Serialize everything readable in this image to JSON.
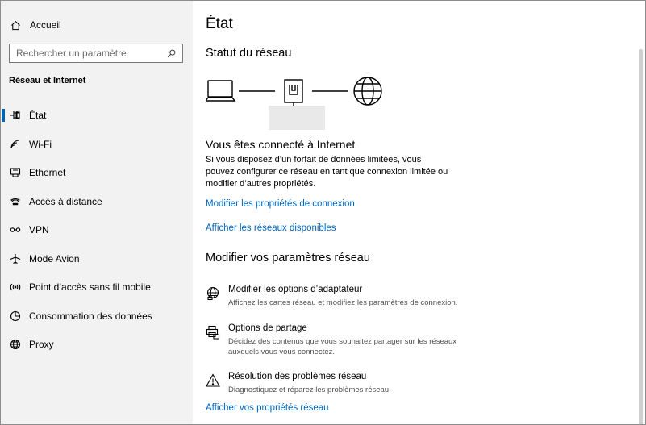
{
  "sidebar": {
    "home_label": "Accueil",
    "search_placeholder": "Rechercher un paramètre",
    "section_title": "Réseau et Internet",
    "items": [
      {
        "label": "État"
      },
      {
        "label": "Wi-Fi"
      },
      {
        "label": "Ethernet"
      },
      {
        "label": "Accès à distance"
      },
      {
        "label": "VPN"
      },
      {
        "label": "Mode Avion"
      },
      {
        "label": "Point d’accès sans fil mobile"
      },
      {
        "label": "Consommation des données"
      },
      {
        "label": "Proxy"
      }
    ]
  },
  "main": {
    "title": "État",
    "network_status_title": "Statut du réseau",
    "connected_title": "Vous êtes connecté à Internet",
    "connected_desc_1": "Si vous disposez d’un forfait de données limitées, vous",
    "connected_desc_2": "pouvez configurer ce réseau en tant que connexion limitée ou",
    "connected_desc_3": "modifier d’autres propriétés.",
    "link_modify_props": "Modifier les propriétés de connexion",
    "link_show_networks": "Afficher les réseaux disponibles",
    "section_modify": "Modifier vos paramètres réseau",
    "options": [
      {
        "title": "Modifier les options d’adaptateur",
        "desc": "Affichez les cartes réseau et modifiez les paramètres de connexion.",
        "icon": "globe-icon"
      },
      {
        "title": "Options de partage",
        "desc_1": "Décidez des contenus que vous souhaitez partager sur les réseaux",
        "desc_2": "auxquels vous vous connectez.",
        "icon": "printer-share-icon"
      },
      {
        "title": "Résolution des problèmes réseau",
        "desc": "Diagnostiquez et réparez les problèmes réseau.",
        "icon": "warning-icon"
      }
    ],
    "link_view_props": "Afficher vos propriétés réseau"
  },
  "colors": {
    "accent": "#0067c0",
    "sidebar_bg": "#f2f2f2",
    "active_bar": "#0063b1"
  }
}
